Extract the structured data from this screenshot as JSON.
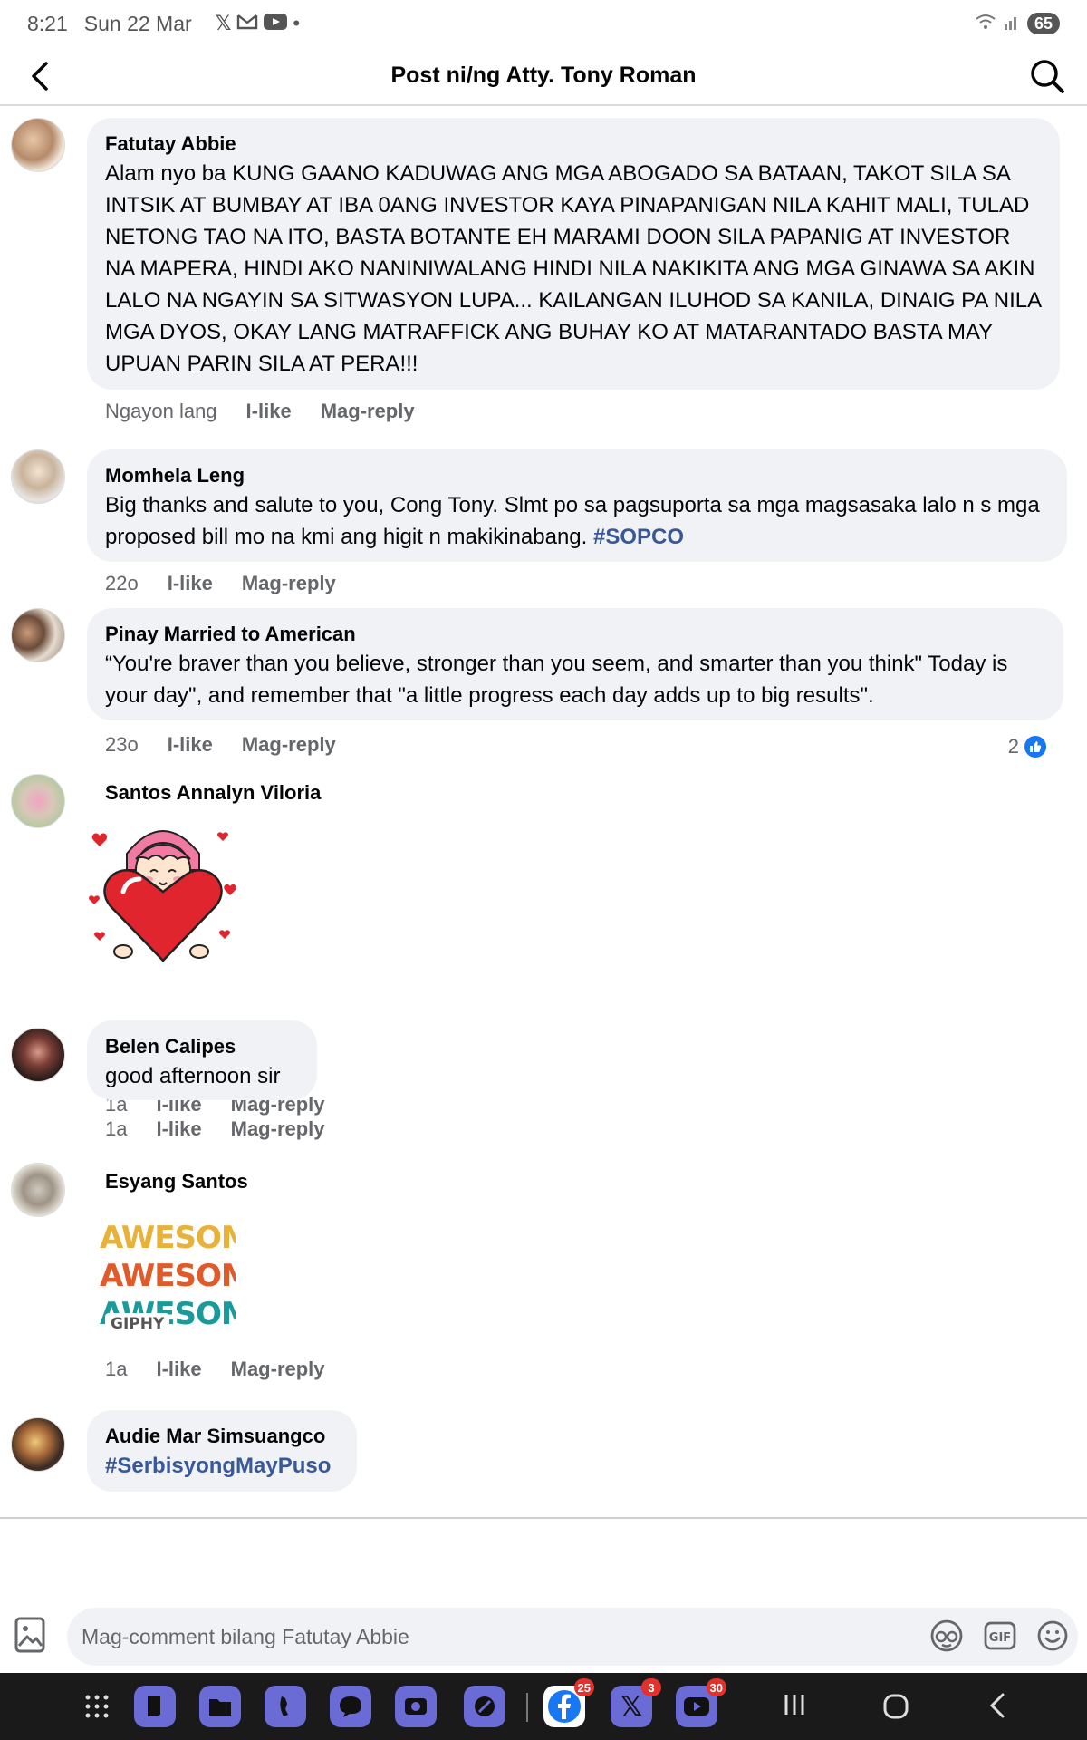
{
  "status_bar": {
    "time": "8:21",
    "date": "Sun 22 Mar",
    "notification_icons": [
      "x-icon",
      "gmail-icon",
      "youtube-icon",
      "dot-icon"
    ],
    "battery": "65"
  },
  "header": {
    "title": "Post ni/ng Atty. Tony Roman"
  },
  "comments": [
    {
      "author": "Fatutay Abbie",
      "text": "Alam nyo ba KUNG GAANO KADUWAG ANG MGA ABOGADO SA BATAAN, TAKOT SILA SA INTSIK AT BUMBAY AT IBA 0ANG INVESTOR KAYA PINAPANIGAN NILA KAHIT MALI, TULAD NETONG TAO NA ITO, BASTA BOTANTE EH MARAMI DOON SILA PAPANIG AT INVESTOR NA MAPERA, HINDI AKO NANINIWALANG HINDI NILA NAKIKITA ANG MGA GINAWA SA AKIN LALO NA NGAYIN SA SITWASYON LUPA... KAILANGAN ILUHOD SA KANILA, DINAIG PA NILA MGA DYOS, OKAY LANG MATRAFFICK ANG BUHAY KO AT MATARANTADO BASTA MAY UPUAN PARIN SILA AT PERA!!!",
      "time": "Ngayon lang",
      "like_label": "I-like",
      "reply_label": "Mag-reply"
    },
    {
      "author": "Momhela Leng",
      "text": "Big thanks and salute to you, Cong Tony. Slmt po sa pagsuporta sa mga magsasaka lalo n s mga proposed bill mo na kmi ang higit n makikinabang. ",
      "hashtag": "#SOPCO",
      "time": "22o",
      "like_label": "I-like",
      "reply_label": "Mag-reply"
    },
    {
      "author": "Pinay Married to American",
      "text": "“You're braver than you believe, stronger than you seem, and smarter than you think\" Today is your day\", and remember that \"a little progress each day adds up to big results\".",
      "time": "23o",
      "like_label": "I-like",
      "reply_label": "Mag-reply",
      "reaction_count": "2"
    },
    {
      "author": "Santos Annalyn Viloria",
      "sticker": "heart-girl-sticker",
      "time": "1a",
      "like_label": "I-like",
      "reply_label": "Mag-reply"
    },
    {
      "author": "Belen Calipes",
      "text": "good afternoon sir",
      "time": "1a",
      "like_label": "I-like",
      "reply_label": "Mag-reply"
    },
    {
      "author": "Esyang Santos",
      "gif_lines": [
        "AWESOME!",
        "AWESOME!",
        "AWESOME!"
      ],
      "gif_source": "GIPHY",
      "time": "1a",
      "like_label": "I-like",
      "reply_label": "Mag-reply"
    },
    {
      "author": "Audie Mar Simsuangco",
      "hashtag": "#SerbisyongMayPuso"
    }
  ],
  "composer": {
    "placeholder": "Mag-comment bilang Fatutay Abbie",
    "icons": [
      "photo-icon",
      "avatar-sticker-icon",
      "gif-icon",
      "emoji-icon"
    ]
  },
  "navbar": {
    "apps": [
      {
        "name": "apps-grid-icon",
        "badge": ""
      },
      {
        "name": "notes-app-icon",
        "badge": ""
      },
      {
        "name": "files-app-icon",
        "badge": ""
      },
      {
        "name": "phone-app-icon",
        "badge": ""
      },
      {
        "name": "messages-app-icon",
        "badge": ""
      },
      {
        "name": "camera-app-icon",
        "badge": ""
      },
      {
        "name": "pen-app-icon",
        "badge": ""
      },
      {
        "name": "facebook-app-icon",
        "badge": "25"
      },
      {
        "name": "x-app-icon",
        "badge": "3"
      },
      {
        "name": "youtube-app-icon",
        "badge": "30"
      }
    ],
    "colors": {
      "dock_tile": "#6b6bd6",
      "facebook": "#1877f2",
      "badge": "#e4312b"
    }
  }
}
